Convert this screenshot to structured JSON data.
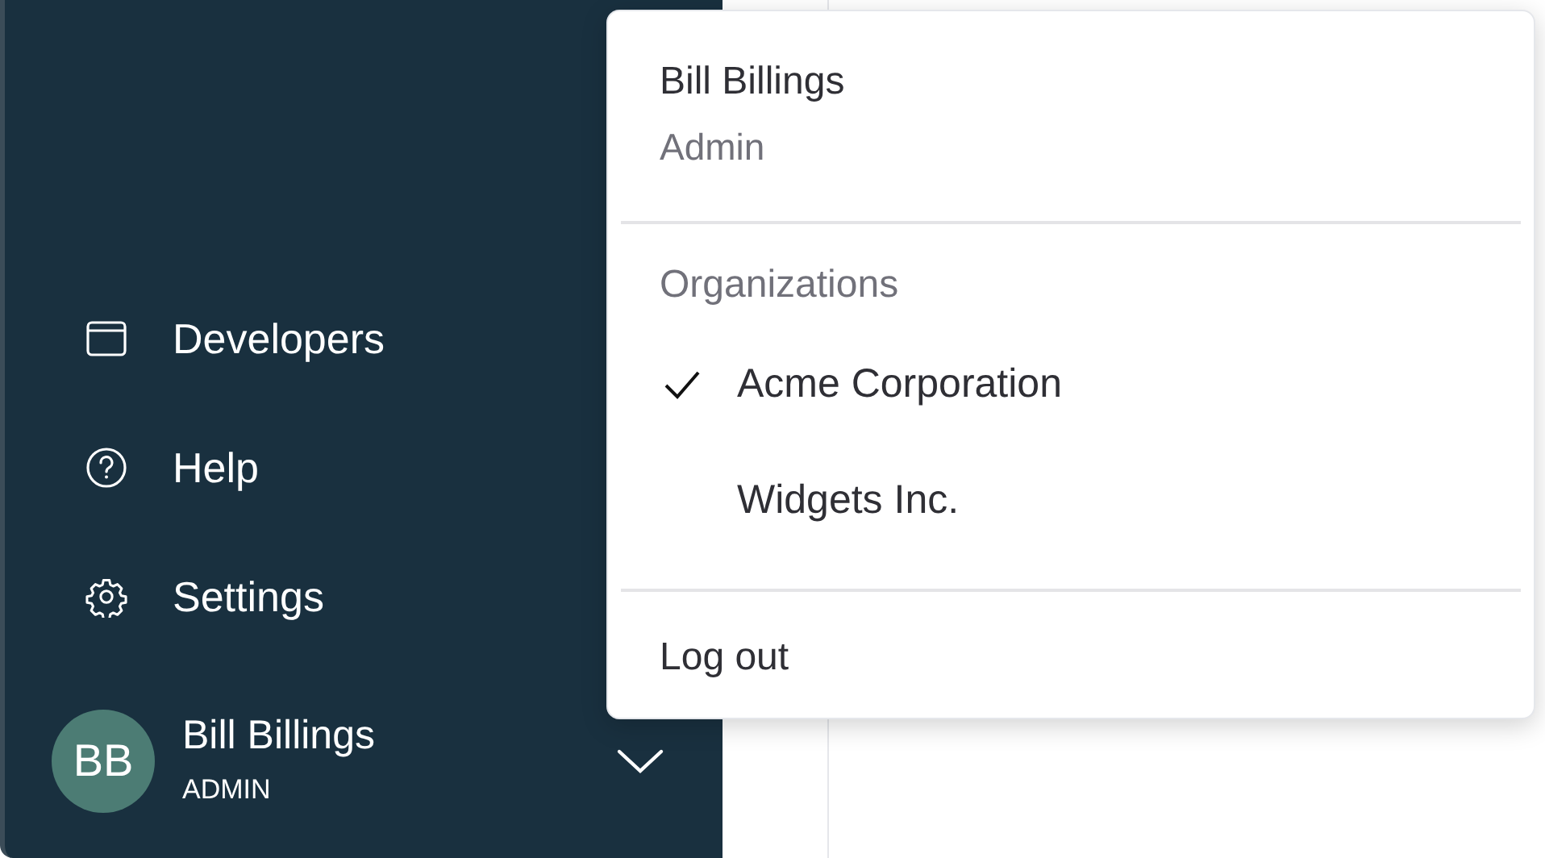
{
  "sidebar": {
    "nav_items": [
      {
        "kind": "window",
        "label": "Developers"
      },
      {
        "kind": "help",
        "label": "Help"
      },
      {
        "kind": "settings",
        "label": "Settings"
      }
    ],
    "user": {
      "initials": "BB",
      "name": "Bill Billings",
      "role": "ADMIN"
    }
  },
  "user_menu": {
    "name": "Bill Billings",
    "role": "Admin",
    "section_title": "Organizations",
    "organizations": [
      {
        "label": "Acme Corporation",
        "selected": true
      },
      {
        "label": "Widgets Inc.",
        "selected": false
      }
    ],
    "logout": "Log out"
  }
}
